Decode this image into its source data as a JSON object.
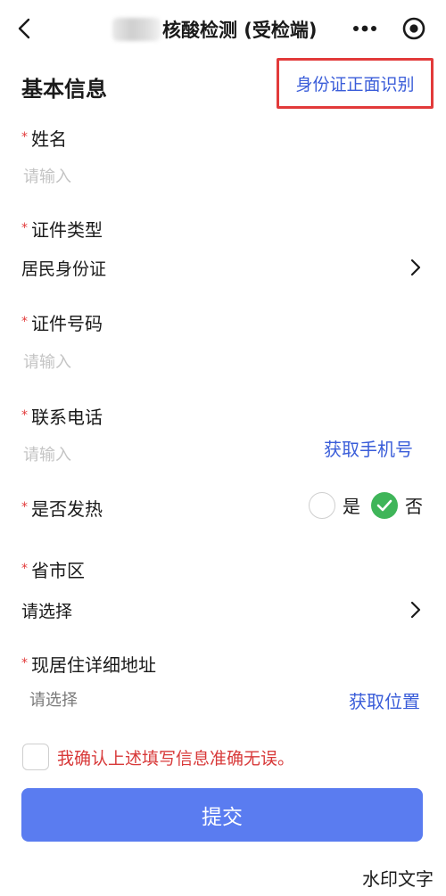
{
  "navbar": {
    "title": "核酸检测 (受检端)"
  },
  "basic_info": {
    "title": "基本信息",
    "ocr_link": "身份证正面识别"
  },
  "fields": {
    "required_mark": "*",
    "name": {
      "label": "姓名",
      "placeholder": "请输入"
    },
    "id_type": {
      "label": "证件类型",
      "value": "居民身份证"
    },
    "id_number": {
      "label": "证件号码",
      "placeholder": "请输入"
    },
    "phone": {
      "label": "联系电话",
      "placeholder": "请输入",
      "action": "获取手机号"
    },
    "fever": {
      "label": "是否发热",
      "option_yes": "是",
      "option_no": "否",
      "selected": "否"
    },
    "region": {
      "label": "省市区",
      "value": "请选择"
    },
    "address": {
      "label": "现居住详细地址",
      "placeholder": "请选择",
      "action": "获取位置"
    }
  },
  "confirm": {
    "text": "我确认上述填写信息准确无误。"
  },
  "submit": {
    "label": "提交"
  },
  "watermark": {
    "text": "水印文字"
  },
  "colors": {
    "accent": "#5a7cf0",
    "link": "#3a5dd9",
    "required": "#e23a3a",
    "checked": "#3fb559"
  }
}
